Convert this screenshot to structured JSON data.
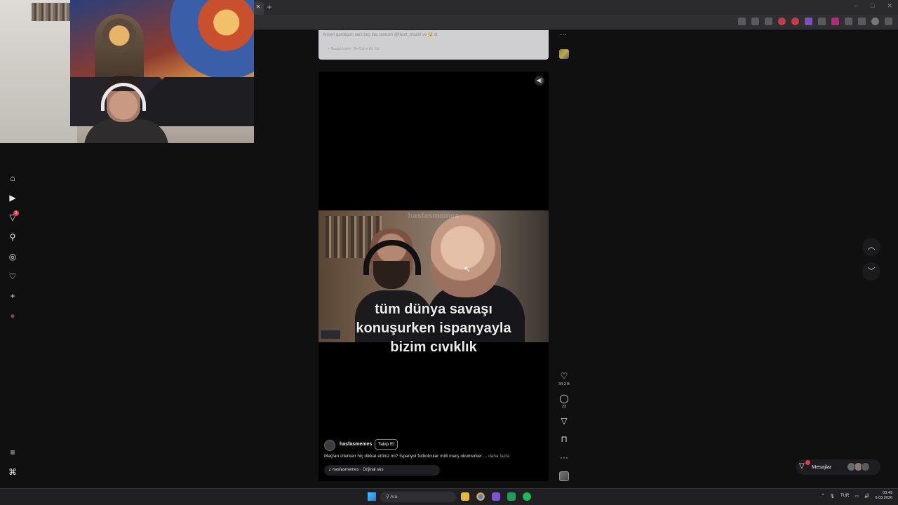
{
  "browser": {
    "tab_close": "×",
    "new_tab": "+",
    "window_controls": [
      "–",
      "□",
      "✕"
    ],
    "toolbar_icons": [
      "cast-icon",
      "star-icon",
      "ext-1-icon",
      "ext-2-icon",
      "ext-3-icon",
      "ext-4-icon",
      "ext-5-icon",
      "ext-6-icon",
      "puzzle-icon",
      "playlist-icon",
      "profile-icon",
      "menu-icon"
    ]
  },
  "sidebar": {
    "items": [
      {
        "name": "home",
        "glyph": "⌂"
      },
      {
        "name": "reels",
        "glyph": "▶"
      },
      {
        "name": "messages",
        "glyph": "▽"
      },
      {
        "name": "search",
        "glyph": "⚲"
      },
      {
        "name": "explore",
        "glyph": "◎"
      },
      {
        "name": "notifications",
        "glyph": "♡"
      },
      {
        "name": "create",
        "glyph": "+"
      },
      {
        "name": "profile",
        "glyph": "●"
      }
    ],
    "badge": "1",
    "bottom_items": [
      {
        "name": "more",
        "glyph": "≡"
      },
      {
        "name": "meta",
        "glyph": "⌘"
      }
    ]
  },
  "previous_post": {
    "line1": "Annen gardaşım seni beş kaç tanesin @fikret_efsaril ve 🥳 di",
    "line2": "↗ Nasipi Arsen · Bir Gün'e Ait Var",
    "more": "···"
  },
  "reel": {
    "mute_glyph": "◀)",
    "watermark": "hasfasmemes",
    "caption_lines": [
      "tüm dünya savaşı",
      "konuşurken ispanyayla",
      "bizim cıvıklık"
    ],
    "username": "hasfasmemes",
    "follow_label": "Takip Et",
    "description": "Maçları izlerken hiç dikkat ettiniz mi? İspanyol futbolcular milli marş okumurker ...",
    "more_label": "daha fazla",
    "audio": "♫ hasfasmemes · Orijinal ses"
  },
  "actions": {
    "like_glyph": "♡",
    "like_count": "34,3 B",
    "comment_glyph": "◯",
    "comment_count": "23",
    "share_glyph": "▽",
    "save_glyph": "⊓",
    "more_glyph": "···"
  },
  "nav": {
    "up_glyph": "︿",
    "down_glyph": "﹀"
  },
  "messages": {
    "label": "Mesajlar",
    "icon": "▽"
  },
  "taskbar": {
    "search_placeholder": "Ara",
    "search_glyph": "⚲",
    "language": "TUR",
    "time": "03:49",
    "date": "6.03.2026",
    "tray_glyphs": [
      "^",
      "🎙",
      "▭",
      "🔊"
    ]
  },
  "colors": {
    "accent_red": "#e33b4b",
    "bg": "#101011"
  }
}
